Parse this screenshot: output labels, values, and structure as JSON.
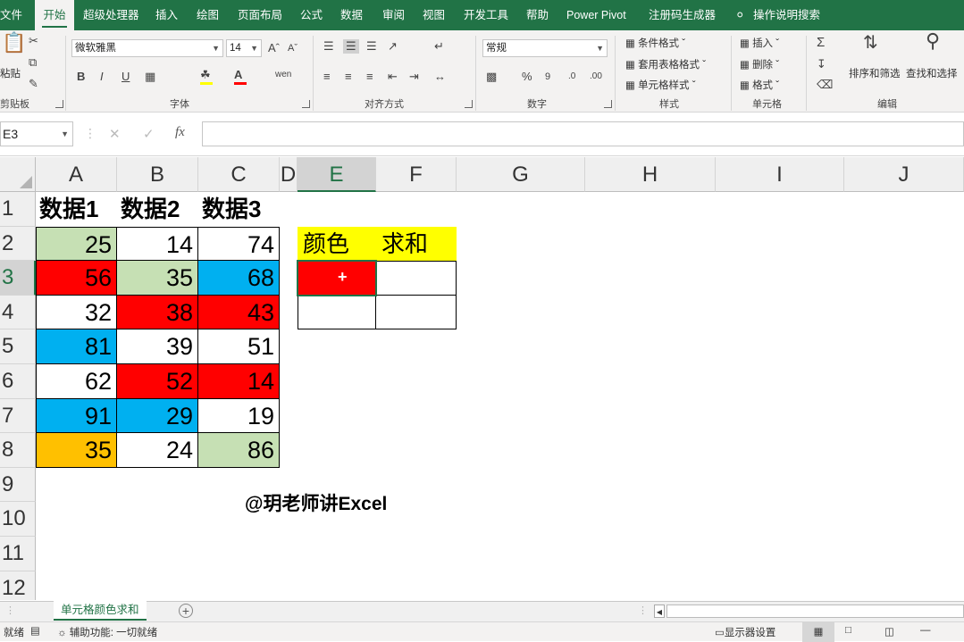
{
  "ribbon_tabs": [
    "文件",
    "开始",
    "超级处理器",
    "插入",
    "绘图",
    "页面布局",
    "公式",
    "数据",
    "审阅",
    "视图",
    "开发工具",
    "帮助",
    "Power Pivot",
    "注册码生成器"
  ],
  "tell_me": "操作说明搜索",
  "clipboard": {
    "paste": "粘贴",
    "label": "剪贴板"
  },
  "font": {
    "name": "微软雅黑",
    "size": "14",
    "bold": "B",
    "italic": "I",
    "underline": "U",
    "label": "字体"
  },
  "alignment": {
    "label": "对齐方式"
  },
  "number": {
    "format": "常规",
    "label": "数字"
  },
  "styles": {
    "conditional": "条件格式",
    "table": "套用表格格式",
    "cell": "单元格样式",
    "label": "样式"
  },
  "cells": {
    "insert": "插入",
    "delete": "删除",
    "format": "格式",
    "label": "单元格"
  },
  "editing": {
    "sort": "排序和筛选",
    "find": "查找和选择",
    "label": "编辑"
  },
  "formula_bar": {
    "name_box": "E3",
    "fx": "fx",
    "content": ""
  },
  "columns": [
    "A",
    "B",
    "C",
    "D",
    "E",
    "F",
    "G",
    "H",
    "I",
    "J"
  ],
  "rows": [
    "1",
    "2",
    "3",
    "4",
    "5",
    "6",
    "7",
    "8",
    "9",
    "10",
    "11",
    "12"
  ],
  "selected_cell": "E3",
  "table": {
    "headers": [
      "数据1",
      "数据2",
      "数据3"
    ],
    "rows": [
      [
        {
          "v": "25",
          "bg": "#c6e0b4"
        },
        {
          "v": "14",
          "bg": "#ffffff"
        },
        {
          "v": "74",
          "bg": "#ffffff"
        }
      ],
      [
        {
          "v": "56",
          "bg": "#ff0000"
        },
        {
          "v": "35",
          "bg": "#c6e0b4"
        },
        {
          "v": "68",
          "bg": "#00b0f0"
        }
      ],
      [
        {
          "v": "32",
          "bg": "#ffffff"
        },
        {
          "v": "38",
          "bg": "#ff0000"
        },
        {
          "v": "43",
          "bg": "#ff0000"
        }
      ],
      [
        {
          "v": "81",
          "bg": "#00b0f0"
        },
        {
          "v": "39",
          "bg": "#ffffff"
        },
        {
          "v": "51",
          "bg": "#ffffff"
        }
      ],
      [
        {
          "v": "62",
          "bg": "#ffffff"
        },
        {
          "v": "52",
          "bg": "#ff0000"
        },
        {
          "v": "14",
          "bg": "#ff0000"
        }
      ],
      [
        {
          "v": "91",
          "bg": "#00b0f0"
        },
        {
          "v": "29",
          "bg": "#00b0f0"
        },
        {
          "v": "19",
          "bg": "#ffffff"
        }
      ],
      [
        {
          "v": "35",
          "bg": "#ffc000"
        },
        {
          "v": "24",
          "bg": "#ffffff"
        },
        {
          "v": "86",
          "bg": "#c6e0b4"
        }
      ]
    ]
  },
  "side_table": {
    "headers": [
      "颜色",
      "求和"
    ],
    "header_bg": "#ffff00",
    "rows": [
      [
        {
          "v": "",
          "bg": "#ff0000"
        },
        {
          "v": "",
          "bg": "#ffffff"
        }
      ],
      [
        {
          "v": "",
          "bg": "#ffffff"
        },
        {
          "v": "",
          "bg": "#ffffff"
        }
      ]
    ]
  },
  "watermark": "@玥老师讲Excel",
  "sheet_tab": "单元格颜色求和",
  "status": {
    "ready": "就绪",
    "accessibility": "辅助功能: 一切就绪",
    "display": "显示器设置"
  },
  "colors": {
    "excel_green": "#217346"
  }
}
